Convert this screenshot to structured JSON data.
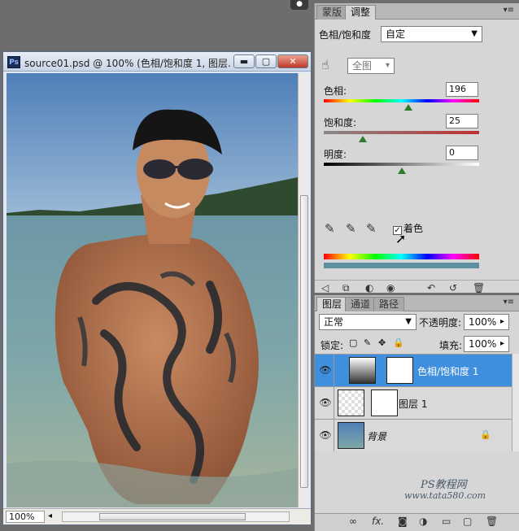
{
  "document": {
    "ps_logo": "Ps",
    "title": "source01.psd @ 100% (色相/饱和度 1, 图层...",
    "zoom": "100%"
  },
  "adjustments": {
    "tabs": [
      "蒙版",
      "调整"
    ],
    "active_tab": "调整",
    "adjustment_label": "色相/饱和度",
    "preset_value": "自定",
    "channel_value": "全图",
    "hue_label": "色相:",
    "hue_value": "196",
    "saturation_label": "饱和度:",
    "saturation_value": "25",
    "lightness_label": "明度:",
    "lightness_value": "0",
    "colorize_label": "着色",
    "colorize_checked": true
  },
  "layers": {
    "tabs": [
      "图层",
      "通道",
      "路径"
    ],
    "blend_mode": "正常",
    "opacity_label": "不透明度:",
    "opacity_value": "100%",
    "lock_label": "锁定:",
    "fill_label": "填充:",
    "fill_value": "100%",
    "items": [
      {
        "name": "色相/饱和度 1",
        "selected": true
      },
      {
        "name": "图层 1",
        "selected": false
      },
      {
        "name": "背景",
        "selected": false
      }
    ]
  },
  "watermark": {
    "site_cn": "PS教程网",
    "site_url": "www.tata580.com"
  }
}
